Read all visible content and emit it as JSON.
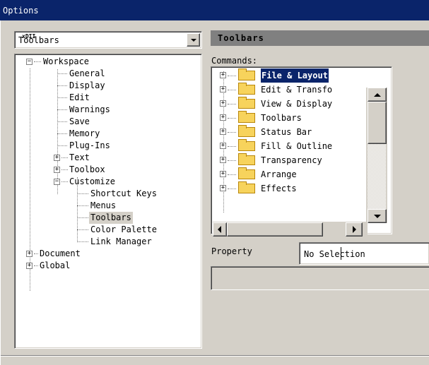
{
  "window": {
    "title": "Options"
  },
  "category_combo": {
    "value": "Toolbars",
    "caret_text": "xDII"
  },
  "tree": [
    {
      "label": "Workspace",
      "expanded": true
    },
    {
      "label": "General"
    },
    {
      "label": "Display"
    },
    {
      "label": "Edit"
    },
    {
      "label": "Warnings"
    },
    {
      "label": "Save"
    },
    {
      "label": "Memory"
    },
    {
      "label": "Plug-Ins"
    },
    {
      "label": "Text",
      "expandable": true
    },
    {
      "label": "Toolbox",
      "expandable": true
    },
    {
      "label": "Customize",
      "expanded": true
    },
    {
      "label": "Shortcut Keys"
    },
    {
      "label": "Menus"
    },
    {
      "label": "Toolbars",
      "selected": true
    },
    {
      "label": "Color Palette"
    },
    {
      "label": "Link Manager"
    },
    {
      "label": "Document",
      "expandable": true
    },
    {
      "label": "Global",
      "expandable": true
    }
  ],
  "panel": {
    "header": "Toolbars",
    "commands_label": "Commands:",
    "commands": [
      {
        "label": "File & Layout",
        "selected": true
      },
      {
        "label": "Edit & Transfo"
      },
      {
        "label": "View & Display"
      },
      {
        "label": "Toolbars"
      },
      {
        "label": "Status Bar"
      },
      {
        "label": "Fill & Outline"
      },
      {
        "label": "Transparency"
      },
      {
        "label": "Arrange"
      },
      {
        "label": "Effects"
      }
    ],
    "property_label": "Property",
    "property_value": "No Selection"
  },
  "colors": {
    "titlebar": "#0a246a",
    "dialog_bg": "#d4d0c8",
    "header_bg": "#808080",
    "selection": "#0a246a",
    "folder": "#f7d35c"
  }
}
